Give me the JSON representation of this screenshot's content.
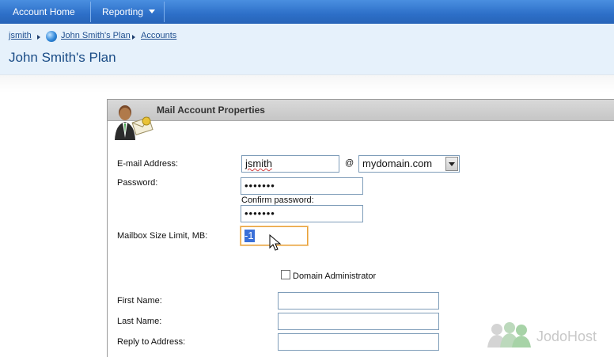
{
  "topnav": {
    "items": [
      {
        "label": "Account Home"
      },
      {
        "label": "Reporting"
      }
    ]
  },
  "breadcrumb": {
    "items": [
      "jsmith",
      "John Smith's Plan",
      "Accounts"
    ]
  },
  "page": {
    "title": "John Smith's Plan"
  },
  "panel": {
    "title": "Mail Account Properties"
  },
  "form": {
    "email_label": "E-mail Address:",
    "email_user": "jsmith",
    "at_sign": "@",
    "domain_selected": "mydomain.com",
    "password_label": "Password:",
    "password_mask": "•••••••",
    "confirm_label": "Confirm password:",
    "confirm_mask": "•••••••",
    "mailbox_label": "Mailbox Size Limit, MB:",
    "mailbox_value": "-1",
    "domain_admin_label": "Domain Administrator",
    "domain_admin_checked": false,
    "first_name_label": "First Name:",
    "first_name_value": "",
    "last_name_label": "Last Name:",
    "last_name_value": "",
    "reply_label": "Reply to Address:",
    "reply_value": ""
  },
  "watermark": {
    "text": "JodoHost"
  },
  "colors": {
    "nav_blue": "#2d6fc8",
    "header_bg": "#e6f1fb",
    "title_blue": "#1a4c86",
    "focus_border": "#e8a23b",
    "selection": "#3a6fd8"
  }
}
